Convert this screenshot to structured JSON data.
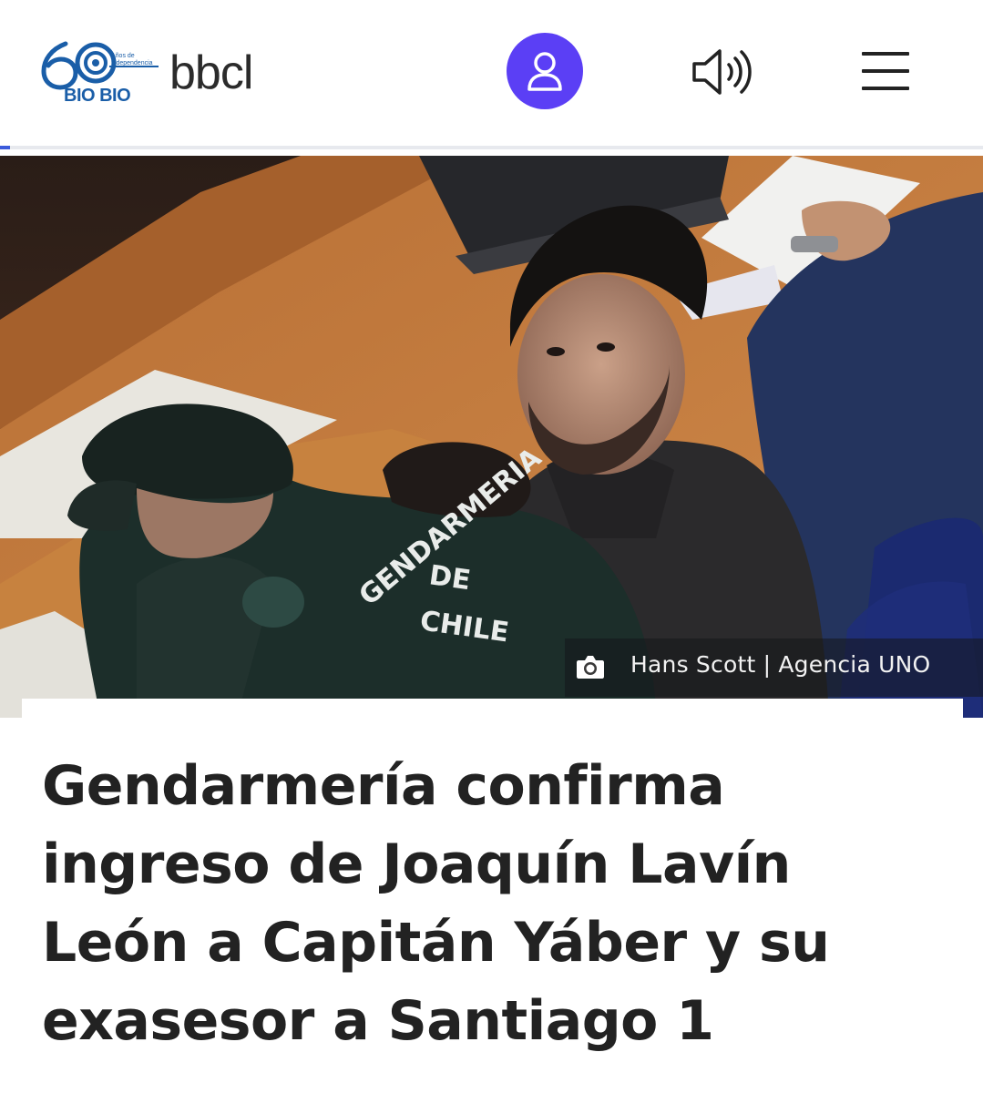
{
  "header": {
    "logo": {
      "anniversary_number": "60",
      "anniversary_text": "Años de independencia",
      "station_name": "BIO BIO",
      "brand": "bbcl"
    },
    "user_icon": "user-icon",
    "audio_icon": "speaker-icon",
    "menu_icon": "hamburger-menu-icon"
  },
  "colors": {
    "accent": "#5b3ff5",
    "brand_blue": "#1a5ea8",
    "progress": "#3b5bdb",
    "headline": "#222222"
  },
  "reading_progress": 0.01,
  "hero": {
    "uniform_text": [
      "GENDARMERIA",
      "DE",
      "CHILE"
    ],
    "credit_icon": "camera-icon",
    "credit": "Hans Scott | Agencia UNO"
  },
  "article": {
    "title": "Gendarmería confirma ingreso de Joaquín Lavín León a Capitán Yáber y su exasesor a Santiago 1"
  }
}
